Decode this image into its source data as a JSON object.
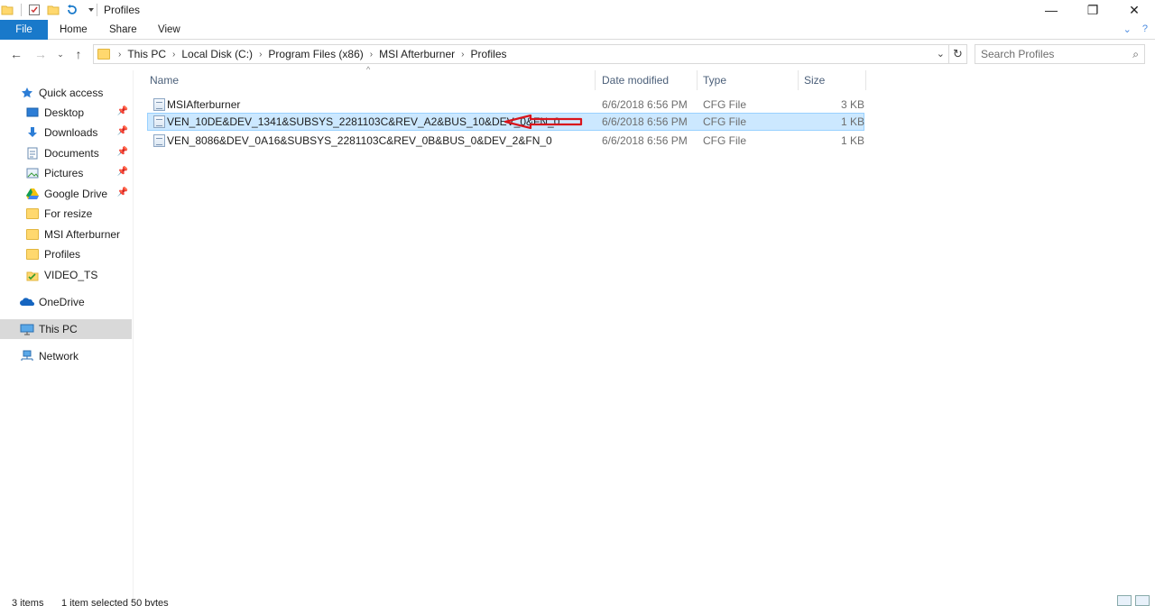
{
  "window": {
    "title": "Profiles",
    "minimize_glyph": "—",
    "restore_glyph": "❐",
    "close_glyph": "✕"
  },
  "ribbon": {
    "tabs": [
      "File",
      "Home",
      "Share",
      "View"
    ]
  },
  "address": {
    "crumbs": [
      "This PC",
      "Local Disk (C:)",
      "Program Files (x86)",
      "MSI Afterburner",
      "Profiles"
    ],
    "search_placeholder": "Search Profiles"
  },
  "nav": {
    "items": [
      {
        "label": "Quick access",
        "icon": "star-icon"
      },
      {
        "label": "Desktop",
        "icon": "desktop-icon",
        "pinned": true
      },
      {
        "label": "Downloads",
        "icon": "download-icon",
        "pinned": true
      },
      {
        "label": "Documents",
        "icon": "documents-icon",
        "pinned": true
      },
      {
        "label": "Pictures",
        "icon": "pictures-icon",
        "pinned": true
      },
      {
        "label": "Google Drive",
        "icon": "google-drive-icon",
        "pinned": true
      },
      {
        "label": "For resize",
        "icon": "folder-icon"
      },
      {
        "label": "MSI Afterburner",
        "icon": "folder-icon"
      },
      {
        "label": "Profiles",
        "icon": "folder-icon"
      },
      {
        "label": "VIDEO_TS",
        "icon": "folder-check-icon"
      },
      {
        "label": "OneDrive",
        "icon": "onedrive-icon"
      },
      {
        "label": "This PC",
        "icon": "computer-icon",
        "selected": true
      },
      {
        "label": "Network",
        "icon": "network-icon"
      }
    ]
  },
  "columns": {
    "name": "Name",
    "date": "Date modified",
    "type": "Type",
    "size": "Size"
  },
  "files": [
    {
      "name": "MSIAfterburner",
      "date": "6/6/2018 6:56 PM",
      "type": "CFG File",
      "size": "3 KB"
    },
    {
      "name": "VEN_10DE&DEV_1341&SUBSYS_2281103C&REV_A2&BUS_10&DEV_0&FN_0",
      "date": "6/6/2018 6:56 PM",
      "type": "CFG File",
      "size": "1 KB",
      "selected": true
    },
    {
      "name": "VEN_8086&DEV_0A16&SUBSYS_2281103C&REV_0B&BUS_0&DEV_2&FN_0",
      "date": "6/6/2018 6:56 PM",
      "type": "CFG File",
      "size": "1 KB"
    }
  ],
  "status": {
    "count": "3 items",
    "selection": "1 item selected 50 bytes"
  },
  "colors": {
    "accent": "#1979ca",
    "selection": "#cce8ff",
    "annotation": "#d9141b"
  }
}
